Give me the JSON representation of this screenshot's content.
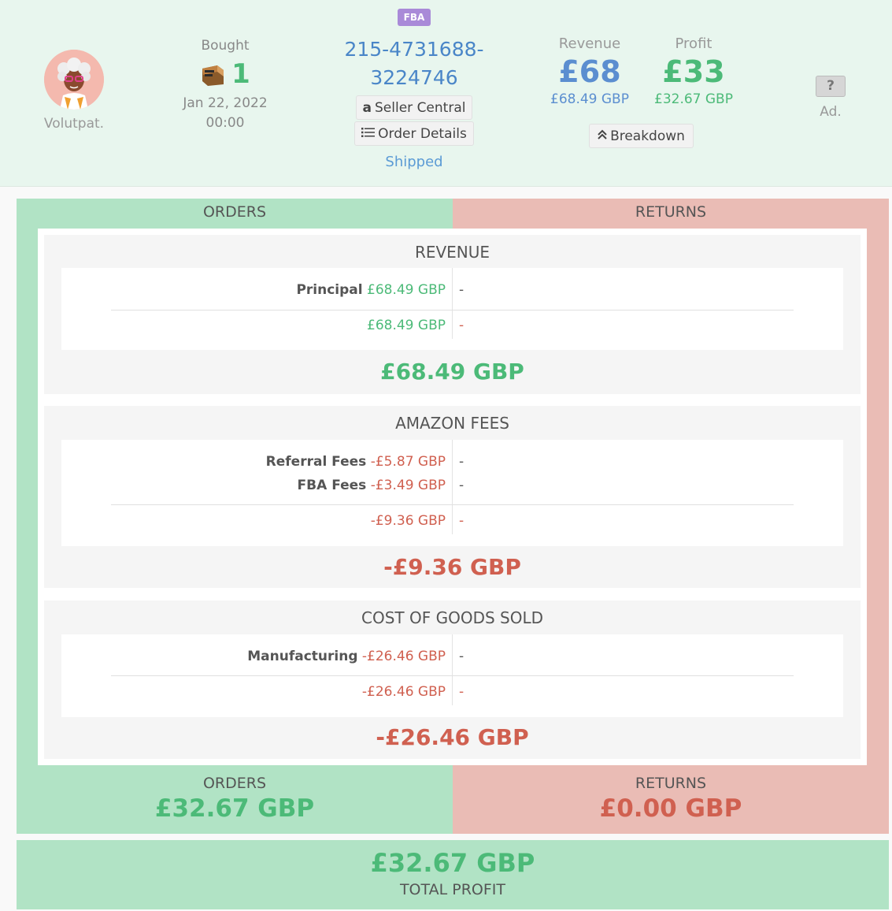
{
  "customer": {
    "name": "Volutpat."
  },
  "bought": {
    "label": "Bought",
    "qty": "1",
    "date": "Jan 22, 2022",
    "time": "00:00"
  },
  "order": {
    "badge": "FBA",
    "id_line1": "215-4731688-",
    "id_line2": "3224746",
    "seller_central": "Seller Central",
    "order_details": "Order Details",
    "status": "Shipped"
  },
  "revenue": {
    "label": "Revenue",
    "big": "£68",
    "small": "£68.49 GBP"
  },
  "profit": {
    "label": "Profit",
    "big": "£33",
    "small": "£32.67 GBP"
  },
  "breakdown_label": "Breakdown",
  "ad": {
    "icon": "?",
    "label": "Ad."
  },
  "columns": {
    "orders": "ORDERS",
    "returns": "RETURNS"
  },
  "sections": {
    "revenue": {
      "title": "REVENUE",
      "rows": [
        {
          "label": "Principal",
          "order": "£68.49 GBP",
          "return": "-"
        }
      ],
      "subtotal": {
        "order": "£68.49 GBP",
        "return": "-"
      },
      "total": "£68.49 GBP"
    },
    "fees": {
      "title": "AMAZON FEES",
      "rows": [
        {
          "label": "Referral Fees",
          "order": "-£5.87 GBP",
          "return": "-"
        },
        {
          "label": "FBA Fees",
          "order": "-£3.49 GBP",
          "return": "-"
        }
      ],
      "subtotal": {
        "order": "-£9.36 GBP",
        "return": "-"
      },
      "total": "-£9.36 GBP"
    },
    "cogs": {
      "title": "COST OF GOODS SOLD",
      "rows": [
        {
          "label": "Manufacturing",
          "order": "-£26.46 GBP",
          "return": "-"
        }
      ],
      "subtotal": {
        "order": "-£26.46 GBP",
        "return": "-"
      },
      "total": "-£26.46 GBP"
    }
  },
  "footer": {
    "orders_label": "ORDERS",
    "orders_value": "£32.67 GBP",
    "returns_label": "RETURNS",
    "returns_value": "£0.00 GBP"
  },
  "total": {
    "value": "£32.67 GBP",
    "label": "TOTAL PROFIT"
  },
  "colors": {
    "green": "#4cba78",
    "red": "#d06050",
    "blue": "#5b8ed0",
    "orders_bg": "#b1e3c5",
    "returns_bg": "#eabcb5",
    "fba_badge": "#a98ad8"
  }
}
